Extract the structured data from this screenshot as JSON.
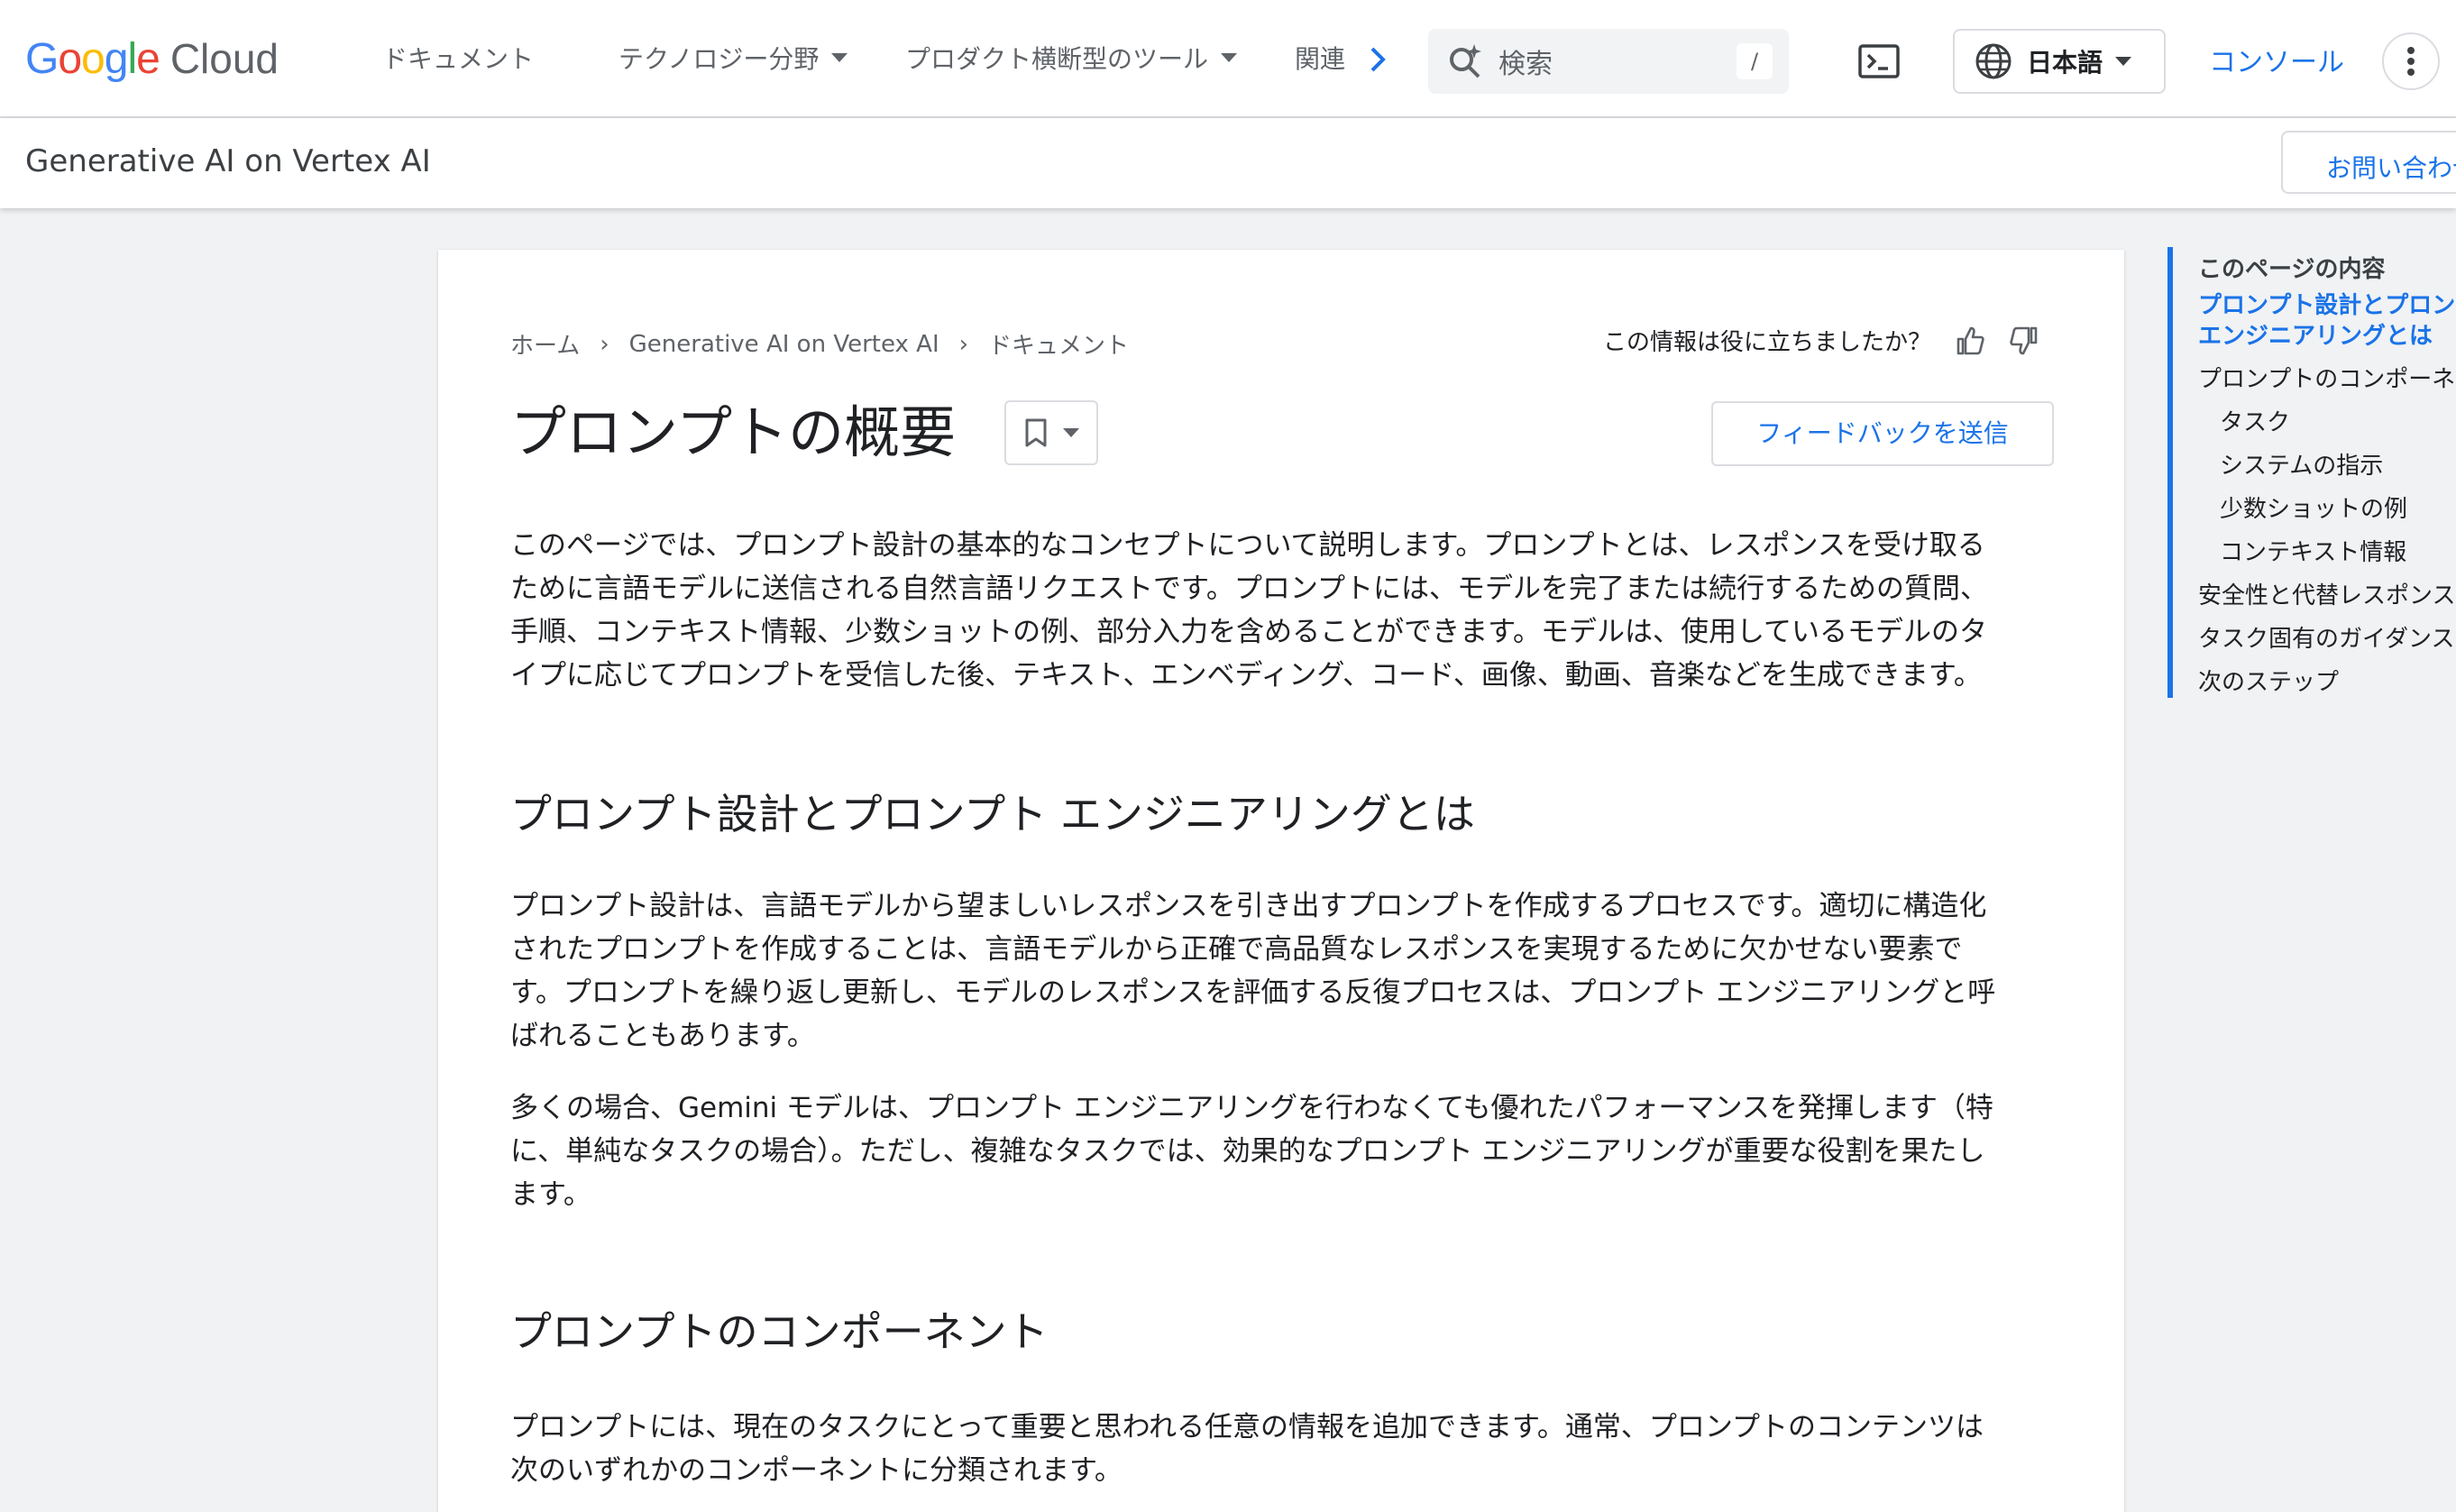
{
  "header": {
    "logo_google": "Google",
    "logo_cloud": "Cloud",
    "nav": [
      {
        "label": "ドキュメント"
      },
      {
        "label": "テクノロジー分野"
      },
      {
        "label": "プロダクト横断型のツール"
      },
      {
        "label": "関連"
      }
    ],
    "search_placeholder": "検索",
    "search_shortcut": "/",
    "language": "日本語",
    "console_label": "コンソール"
  },
  "subheader": {
    "product": "Generative AI on Vertex AI",
    "contact_label": "お問い合わせ"
  },
  "article": {
    "breadcrumb": [
      "ホーム",
      "Generative AI on Vertex AI",
      "ドキュメント"
    ],
    "helpful_question": "この情報は役に立ちましたか？",
    "title": "プロンプトの概要",
    "feedback_label": "フィードバックを送信",
    "intro_lines": [
      "このページでは、プロンプト設計の基本的なコンセプトについて説明します。プロンプトとは、レスポンスを受け取る",
      "ために言語モデルに送信される自然言語リクエストです。プロンプトには、モデルを完了または続行するための質問、",
      "手順、コンテキスト情報、少数ショットの例、部分入力を含めることができます。モデルは、使用しているモデルのタ",
      "イプに応じてプロンプトを受信した後、テキスト、エンベディング、コード、画像、動画、音楽などを生成できます。"
    ],
    "section1_heading": "プロンプト設計とプロンプト エンジニアリングとは",
    "section1_p1_lines": [
      "プロンプト設計は、言語モデルから望ましいレスポンスを引き出すプロンプトを作成するプロセスです。適切に構造化",
      "されたプロンプトを作成することは、言語モデルから正確で高品質なレスポンスを実現するために欠かせない要素で",
      "す。プロンプトを繰り返し更新し、モデルのレスポンスを評価する反復プロセスは、プロンプト エンジニアリングと呼",
      "ばれることもあります。"
    ],
    "section1_p2_lines": [
      "多くの場合、Gemini モデルは、プロンプト エンジニアリングを行わなくても優れたパフォーマンスを発揮します（特",
      "に、単純なタスクの場合）。ただし、複雑なタスクでは、効果的なプロンプト エンジニアリングが重要な役割を果たし",
      "ます。"
    ],
    "section2_heading": "プロンプトのコンポーネント",
    "section2_p1_lines": [
      "プロンプトには、現在のタスクにとって重要と思われる任意の情報を追加できます。通常、プロンプトのコンテンツは",
      "次のいずれかのコンポーネントに分類されます。"
    ]
  },
  "toc": {
    "title": "このページの内容",
    "items": [
      {
        "label": "プロンプト設計とプロンプト エンジニアリングとは",
        "line1": "プロンプト設計とプロンプト",
        "line2": "エンジニアリングとは"
      },
      {
        "label": "プロンプトのコンポーネント"
      },
      {
        "label": "タスク"
      },
      {
        "label": "システムの指示"
      },
      {
        "label": "少数ショットの例"
      },
      {
        "label": "コンテキスト情報"
      },
      {
        "label": "安全性と代替レスポンス"
      },
      {
        "label": "タスク固有のガイダンス"
      },
      {
        "label": "次のステップ"
      }
    ]
  },
  "colors": {
    "accent": "#1a73e8",
    "page_background": "#f0f2f4",
    "text": "#202124"
  }
}
